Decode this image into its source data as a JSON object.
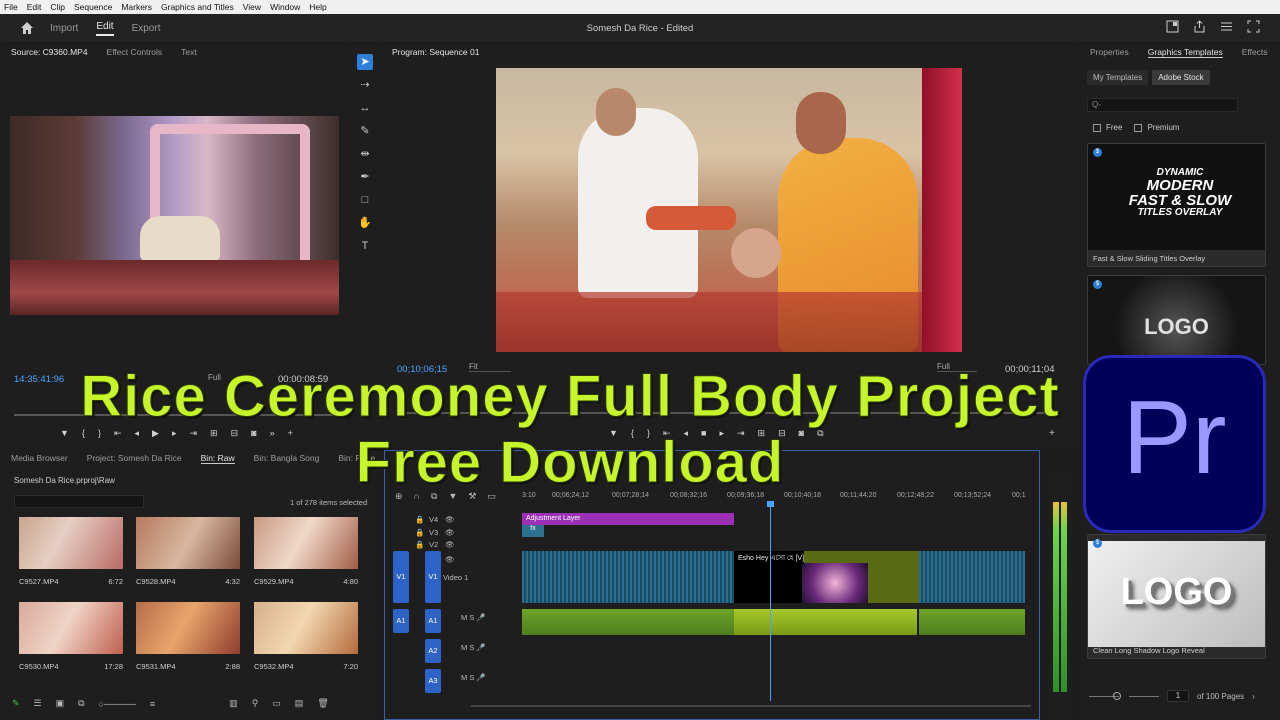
{
  "menu": [
    "File",
    "Edit",
    "Clip",
    "Sequence",
    "Markers",
    "Graphics and Titles",
    "View",
    "Window",
    "Help"
  ],
  "header": {
    "workspaces": [
      "Import",
      "Edit",
      "Export"
    ],
    "title": "Somesh Da Rice - Edited"
  },
  "source": {
    "tabs": [
      "Source: C9360.MP4",
      "Effect Controls",
      "Text"
    ],
    "timecode": "14:35:41:96",
    "fit": "Full",
    "duration": "00:00:08:59"
  },
  "program": {
    "tab": "Program: Sequence 01",
    "timecode": "00;10;06;15",
    "fit": "Fit",
    "quality": "Full",
    "duration": "00;00;11;04"
  },
  "right_panel": {
    "tabs": [
      "Properties",
      "Graphics Templates",
      "Effects"
    ],
    "subtabs": [
      "My Templates",
      "Adobe Stock"
    ],
    "search_placeholder": "Q-",
    "filters": [
      "Free",
      "Premium"
    ],
    "templates": [
      {
        "caption": "Fast & Slow Sliding Titles Overlay",
        "lines": [
          "DYNAMIC",
          "MODERN",
          "FAST & SLOW",
          "TITLES OVERLAY"
        ]
      },
      {
        "caption": "",
        "logo": "LOGO"
      },
      {
        "caption": "Clean Long Shadow Logo Reveal",
        "logo": "LOGO"
      }
    ],
    "page": "1",
    "page_total": "of 100 Pages"
  },
  "project": {
    "tabs": [
      "Media Browser",
      "Project: Somesh Da Rice",
      "Bin: Raw",
      "Bin: Bangla Song",
      "Bin: Proje"
    ],
    "path": "Somesh Da Rice.prproj\\Raw",
    "count": "1 of 278 items selected",
    "clips": [
      {
        "name": "C9527.MP4",
        "dur": "6:72"
      },
      {
        "name": "C9528.MP4",
        "dur": "4:32"
      },
      {
        "name": "C9529.MP4",
        "dur": "4:80"
      },
      {
        "name": "C9530.MP4",
        "dur": "17:28"
      },
      {
        "name": "C9531.MP4",
        "dur": "2:88"
      },
      {
        "name": "C9532.MP4",
        "dur": "7:20"
      }
    ]
  },
  "timeline": {
    "ruler": [
      "3:10",
      "00;06;24;12",
      "00;07;28;14",
      "00;08;32;16",
      "00;09;36;18",
      "00;10;40;18",
      "00;11;44;20",
      "00;12;48;22",
      "00;13;52;24",
      "00;1"
    ],
    "tracks_video": [
      "V4",
      "V3",
      "V2",
      "V1"
    ],
    "track_v1_name": "Video 1",
    "tracks_audio": [
      "A1",
      "A2",
      "A3"
    ],
    "adjustment_label": "Adjustment Layer",
    "clip_label": "Esho Hey এসো হে  [V]",
    "fx": "fx"
  },
  "overlay": {
    "line1": "Rice Ceremoney Full Body Project",
    "line2": "Free Download"
  },
  "app_logo": "Pr"
}
